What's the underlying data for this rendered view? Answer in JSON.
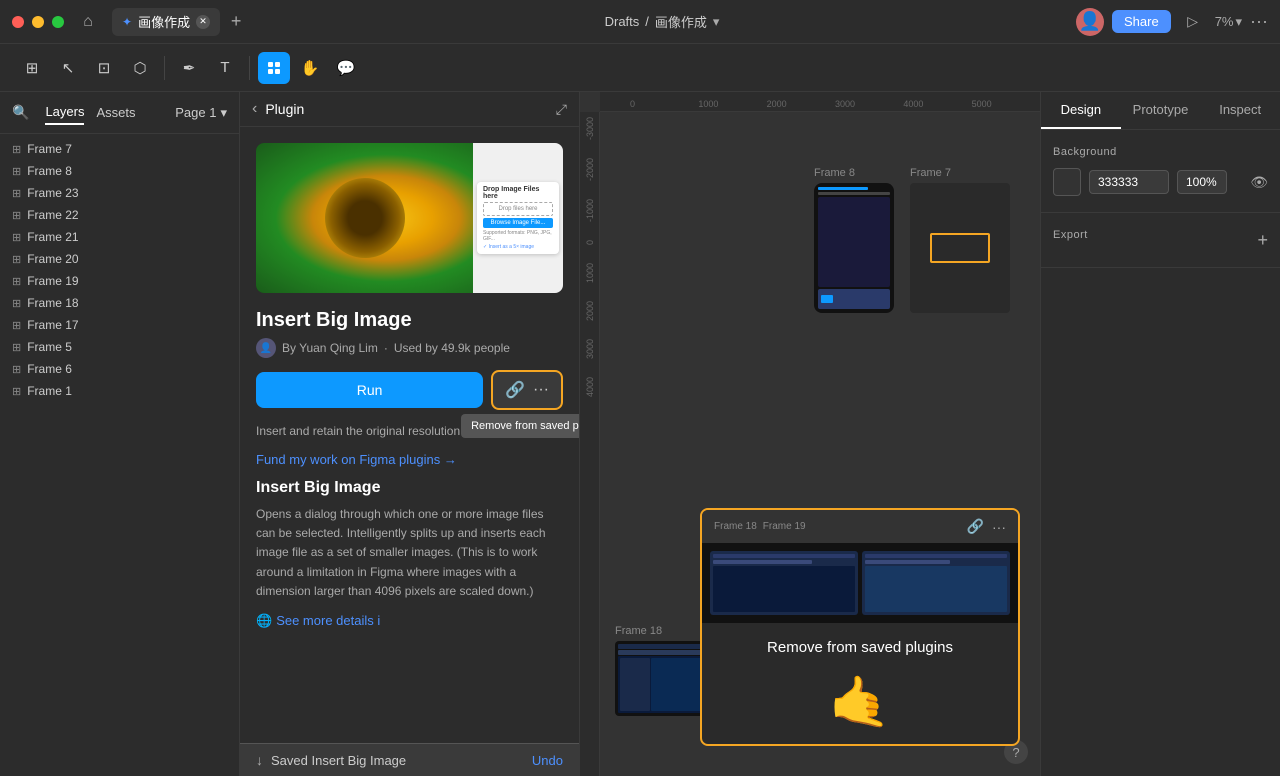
{
  "titlebar": {
    "app_name": "画像作成",
    "breadcrumb": "Drafts",
    "breadcrumb_separator": "/",
    "zoom": "7%",
    "share_label": "Share"
  },
  "toolbar": {
    "tools": [
      "grid",
      "cursor",
      "frame",
      "shape",
      "pen",
      "text",
      "components",
      "hand",
      "comment"
    ]
  },
  "left_panel": {
    "tabs": [
      "Layers",
      "Assets"
    ],
    "page": "Page 1",
    "layers": [
      "Frame 7",
      "Frame 8",
      "Frame 23",
      "Frame 22",
      "Frame 21",
      "Frame 20",
      "Frame 19",
      "Frame 18",
      "Frame 17",
      "Frame 5",
      "Frame 6",
      "Frame 1"
    ]
  },
  "plugin": {
    "title": "Plugin",
    "name": "Insert Big Image",
    "author": "By Yuan Qing Lim",
    "users": "Used by 49.9k people",
    "run_label": "Run",
    "link_text": "Fund my work on Figma plugins →",
    "desc_short": "Insert and retain the original resolution of big i",
    "about_title": "Insert Big Image",
    "about_desc": "Opens a dialog through which one or more image files can be selected. Intelligently splits up and inserts each image file as a set of smaller images. (This is to work around a limitation in Figma where images with a dimension larger than 4096 pixels are scaled down.)",
    "see_more": "See more details i",
    "popup_tooltip": "Remove from saved plu",
    "popup_big_text": "Remove from saved plugins"
  },
  "right_panel": {
    "tabs": [
      "Design",
      "Prototype",
      "Inspect"
    ],
    "active_tab": "Design",
    "background_label": "Background",
    "bg_hex": "333333",
    "bg_opacity": "100%",
    "export_label": "Export"
  },
  "saved_bar": {
    "text": "Saved Insert Big Image",
    "undo": "Undo"
  },
  "canvas": {
    "ruler_marks": [
      "0",
      "1000",
      "2000",
      "3000",
      "4000",
      "5000"
    ],
    "ruler_v_marks": [
      "-3000",
      "-2000",
      "-1000",
      "0",
      "1000",
      "2000",
      "3000",
      "4000"
    ]
  }
}
